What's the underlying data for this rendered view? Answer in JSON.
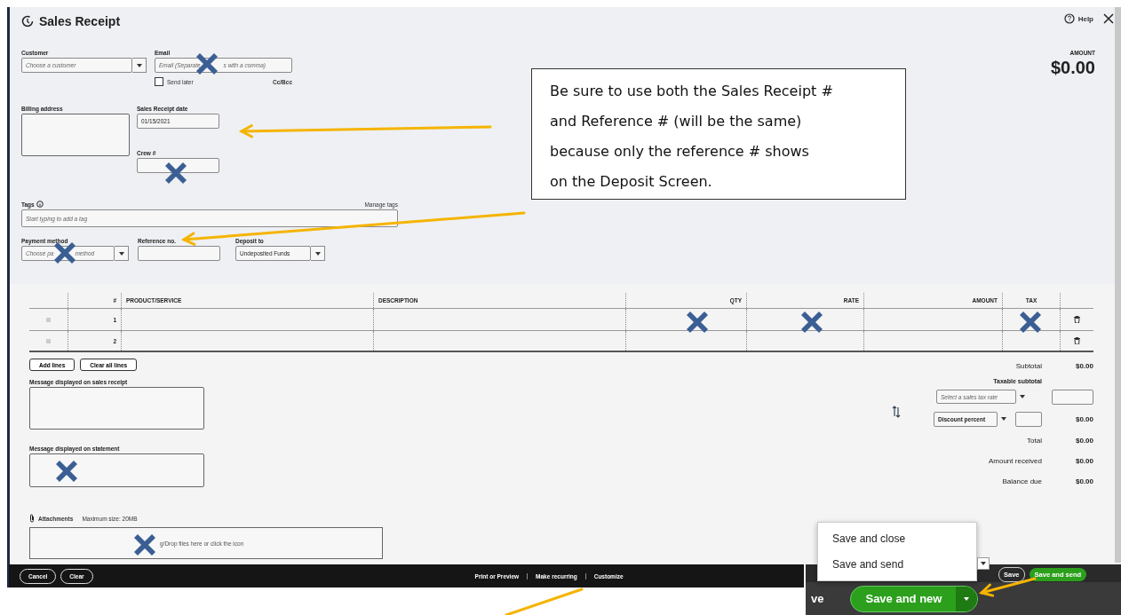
{
  "header": {
    "title": "Sales Receipt",
    "help": "Help"
  },
  "amount": {
    "label": "AMOUNT",
    "value": "$0.00"
  },
  "customer": {
    "label": "Customer",
    "placeholder": "Choose a customer"
  },
  "email": {
    "label": "Email",
    "placeholder_parts": [
      "Email (Separate",
      "s with a comma)"
    ],
    "cc_bcc": "Cc/Bcc"
  },
  "send_later": {
    "label": "Send later",
    "checked": false
  },
  "billing_address": {
    "label": "Billing address"
  },
  "receipt_date": {
    "label": "Sales Receipt date",
    "value": "01/15/2021"
  },
  "crew": {
    "label": "Crew #"
  },
  "tags": {
    "label": "Tags",
    "manage": "Manage tags",
    "placeholder": "Start typing to add a tag"
  },
  "payment_method": {
    "label": "Payment method",
    "placeholder_parts": [
      "Choose pa",
      "method"
    ]
  },
  "reference": {
    "label": "Reference no."
  },
  "deposit_to": {
    "label": "Deposit to",
    "value": "Undeposited Funds"
  },
  "table": {
    "columns": [
      "#",
      "PRODUCT/SERVICE",
      "DESCRIPTION",
      "QTY",
      "RATE",
      "AMOUNT",
      "TAX"
    ],
    "rows": [
      {
        "number": "1"
      },
      {
        "number": "2"
      }
    ]
  },
  "line_buttons": [
    "Add lines",
    "Clear all lines"
  ],
  "message_receipt": {
    "label": "Message displayed on sales receipt"
  },
  "message_statement": {
    "label": "Message displayed on statement"
  },
  "attachments": {
    "label": "Attachments",
    "max_size": "Maximum size: 20MB",
    "drop": "g/Drop files here or click the icon"
  },
  "totals": {
    "subtotal": {
      "label": "Subtotal",
      "value": "$0.00"
    },
    "taxable": "Taxable subtotal",
    "tax_rate_placeholder": "Select a sales tax rate",
    "discount": {
      "label": "Discount percent",
      "value": "$0.00"
    },
    "rows": [
      {
        "label": "Total",
        "value": "$0.00"
      },
      {
        "label": "Amount received",
        "value": "$0.00"
      },
      {
        "label": "Balance due",
        "value": "$0.00"
      }
    ]
  },
  "footer": {
    "left": [
      "Cancel",
      "Clear"
    ],
    "center": [
      "Print or Preview",
      "Make recurring",
      "Customize"
    ]
  },
  "save_menu": [
    "Save and close",
    "Save and send"
  ],
  "save_bar": {
    "cut_button": "ve",
    "primary": "Save and new",
    "save": "Save",
    "save_send": "Save and send"
  },
  "callout": [
    "Be sure to use both the Sales Receipt #",
    "and Reference # (will be the same)",
    "because only the reference # shows",
    "on the Deposit Screen."
  ]
}
